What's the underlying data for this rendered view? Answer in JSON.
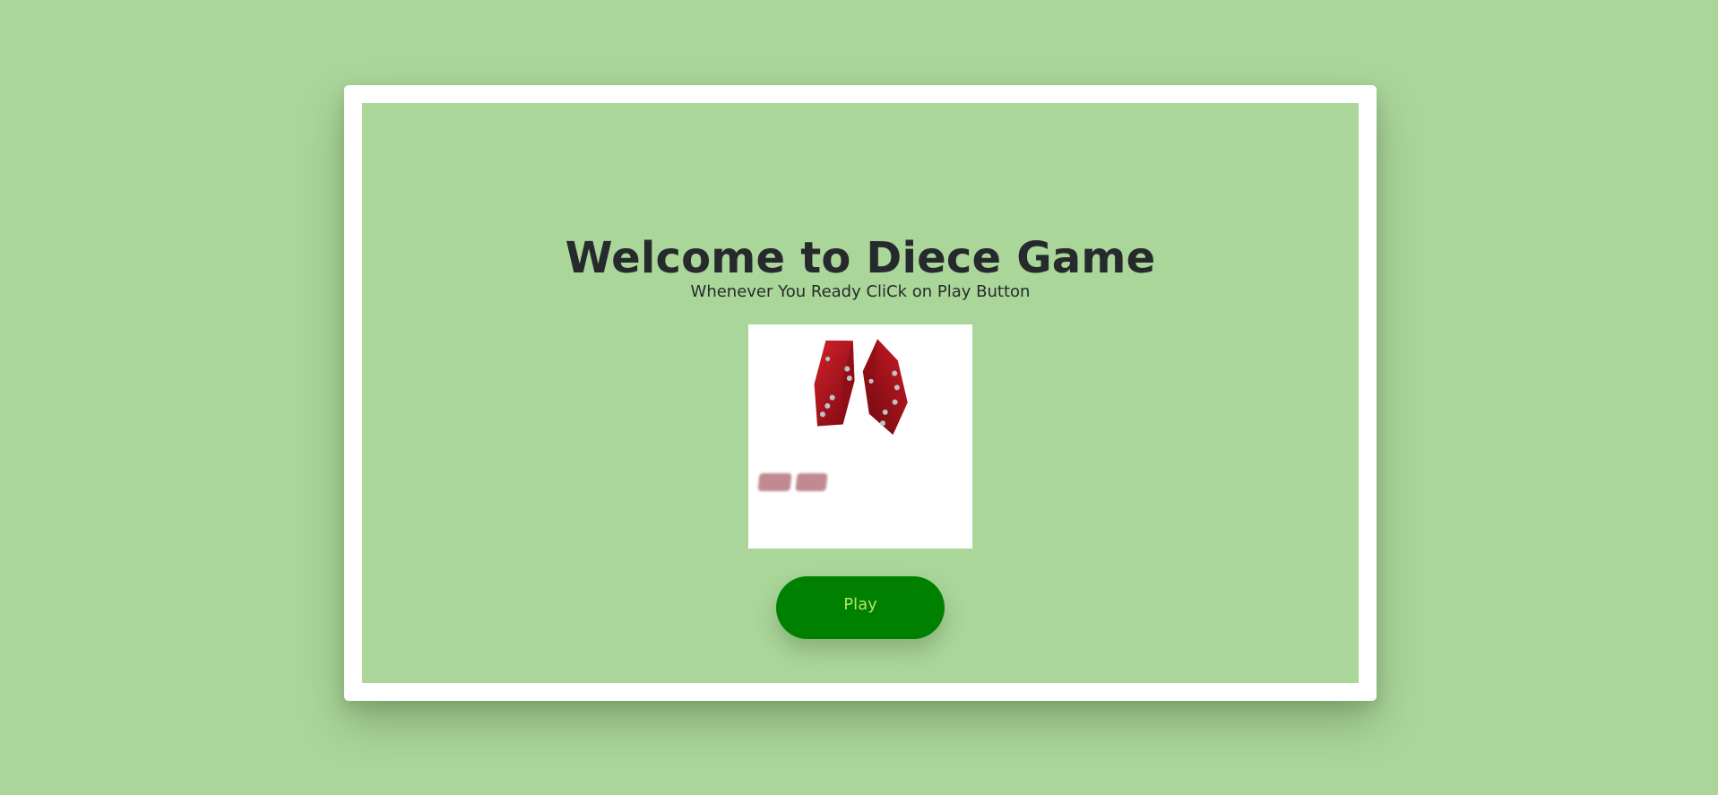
{
  "header": {
    "title": "Welcome to Diece Game",
    "subtitle": "Whenever You Ready CliCk on Play Button"
  },
  "illustration": {
    "icon": "dice-icon",
    "count": 2
  },
  "actions": {
    "play_label": "Play"
  },
  "colors": {
    "background": "#abd69a",
    "frame": "#ffffff",
    "play_button": "#008000",
    "play_text": "#b5e26a",
    "title_text": "#262a2c",
    "dice": "#b5121b"
  }
}
